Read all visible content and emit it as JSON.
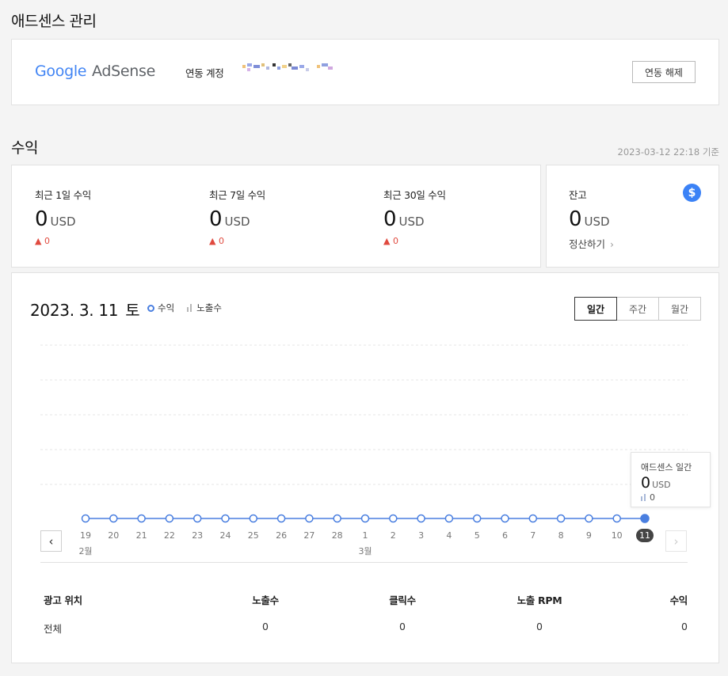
{
  "section1": {
    "title": "애드센스 관리"
  },
  "account": {
    "logo_google": "Google",
    "logo_adsense": "AdSense",
    "linked_label": "연동 계정",
    "unlink_button": "연동 해제"
  },
  "revenue": {
    "title": "수익",
    "timestamp": "2023-03-12 22:18 기준",
    "cards": [
      {
        "label": "최근 1일 수익",
        "value": "0",
        "unit": "USD",
        "change": "0"
      },
      {
        "label": "최근 7일 수익",
        "value": "0",
        "unit": "USD",
        "change": "0"
      },
      {
        "label": "최근 30일 수익",
        "value": "0",
        "unit": "USD",
        "change": "0"
      }
    ],
    "balance": {
      "label": "잔고",
      "value": "0",
      "unit": "USD",
      "link": "정산하기",
      "icon": "dollar-icon"
    }
  },
  "chart": {
    "date": "2023. 3. 11",
    "weekday": "토",
    "legend": {
      "revenue": "수익",
      "impressions": "노출수"
    },
    "tabs": [
      "일간",
      "주간",
      "월간"
    ],
    "active_tab": 0,
    "tooltip": {
      "title": "애드센스 일간",
      "value": "0",
      "unit": "USD",
      "impressions": "0"
    },
    "month_labels": [
      {
        "text": "2월",
        "index": 0
      },
      {
        "text": "3월",
        "index": 10
      }
    ],
    "colors": {
      "line": "#4a7fe0",
      "grid": "#e4e4e4"
    }
  },
  "chart_data": {
    "type": "line",
    "x": [
      "19",
      "20",
      "21",
      "22",
      "23",
      "24",
      "25",
      "26",
      "27",
      "28",
      "1",
      "2",
      "3",
      "4",
      "5",
      "6",
      "7",
      "8",
      "9",
      "10",
      "11"
    ],
    "series": [
      {
        "name": "수익",
        "values": [
          0,
          0,
          0,
          0,
          0,
          0,
          0,
          0,
          0,
          0,
          0,
          0,
          0,
          0,
          0,
          0,
          0,
          0,
          0,
          0,
          0
        ]
      }
    ],
    "selected_index": 20
  },
  "table": {
    "headers": [
      "광고 위치",
      "노출수",
      "클릭수",
      "노출 RPM",
      "수익"
    ],
    "rows": [
      [
        "전체",
        "0",
        "0",
        "0",
        "0"
      ]
    ]
  }
}
